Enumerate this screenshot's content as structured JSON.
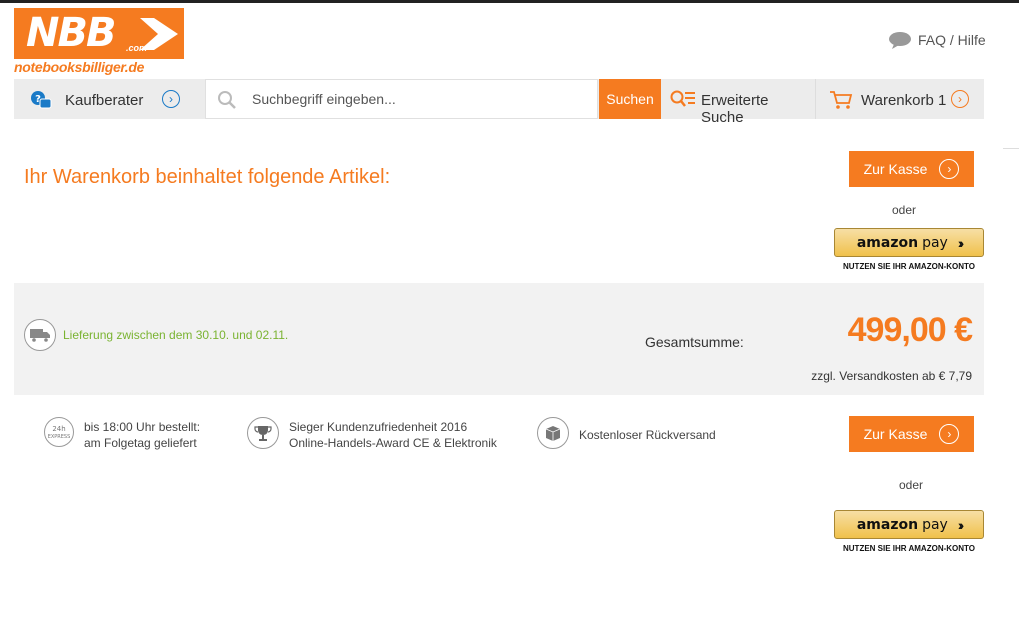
{
  "logo": {
    "text": "NBB",
    "com": ".com",
    "sub": "notebooksbilliger.de"
  },
  "header": {
    "faq_label": "FAQ / Hilfe"
  },
  "nav": {
    "kaufberater": "Kaufberater",
    "search_placeholder": "Suchbegriff eingeben...",
    "search_button": "Suchen",
    "advanced_search": "Erweiterte Suche",
    "cart": "Warenkorb 1"
  },
  "main": {
    "heading": "Ihr Warenkorb beinhaltet folgende Artikel:",
    "checkout_label": "Zur Kasse",
    "or_label": "oder",
    "amazon": {
      "brand": "amazon",
      "pay": "pay",
      "note": "NUTZEN SIE IHR AMAZON-KONTO"
    }
  },
  "summary": {
    "delivery": "Lieferung zwischen dem 30.10. und 02.11.",
    "total_label": "Gesamtsumme:",
    "total_value": "499,00 €",
    "shipping": "zzgl. Versandkosten ab € 7,79"
  },
  "features": [
    {
      "icon": "24h-express-icon",
      "line1": "bis 18:00 Uhr bestellt:",
      "line2": "am Folgetag geliefert"
    },
    {
      "icon": "trophy-icon",
      "line1": "Sieger Kundenzufriedenheit 2016",
      "line2": "Online-Handels-Award CE & Elektronik"
    },
    {
      "icon": "package-icon",
      "line1": "Kostenloser Rückversand",
      "line2": ""
    }
  ],
  "colors": {
    "brand": "#f57b20",
    "delivery": "#7ab331",
    "nav_bg": "#ececec",
    "summary_bg": "#f2f2f2"
  }
}
